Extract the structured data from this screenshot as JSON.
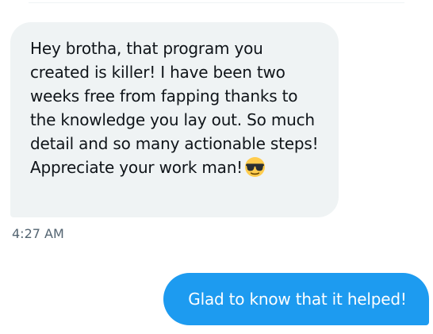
{
  "conversation": {
    "received_message": {
      "text": "Hey brotha, that program you created is killer! I have been two weeks free from fapping thanks to the knowledge you lay out. So much detail and so many actionable steps! Appreciate your work man!",
      "emoji_icon": "smiling-face-with-sunglasses-icon",
      "timestamp": "4:27 AM"
    },
    "sent_message": {
      "text": "Glad to know that it helped!"
    }
  },
  "colors": {
    "received_bubble": "#eff3f4",
    "received_text": "#0f1419",
    "sent_bubble": "#1d9bf0",
    "sent_text": "#ffffff",
    "timestamp": "#536471"
  }
}
